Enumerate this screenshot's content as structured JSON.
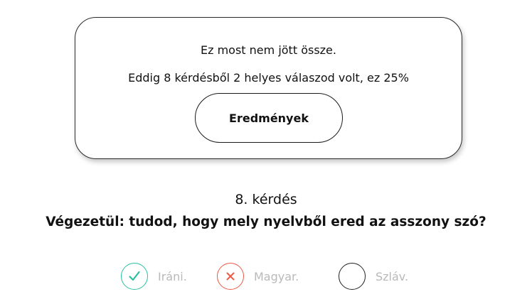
{
  "result": {
    "message": "Ez most nem jött össze.",
    "summary": "Eddig 8 kérdésből 2 helyes válaszod volt, ez 25%",
    "button_label": "Eredmények"
  },
  "question": {
    "number_label": "8. kérdés",
    "text": "Végezetül: tudod, hogy mely nyelvből ered az asszony szó?"
  },
  "answers": [
    {
      "label": "Iráni.",
      "state": "correct",
      "icon": "check-icon"
    },
    {
      "label": "Magyar.",
      "state": "wrong",
      "icon": "cross-icon"
    },
    {
      "label": "Szláv.",
      "state": "neutral",
      "icon": ""
    }
  ],
  "colors": {
    "correct": "#2bc0a0",
    "wrong": "#ee5a46",
    "muted_text": "#b9b9b9"
  }
}
